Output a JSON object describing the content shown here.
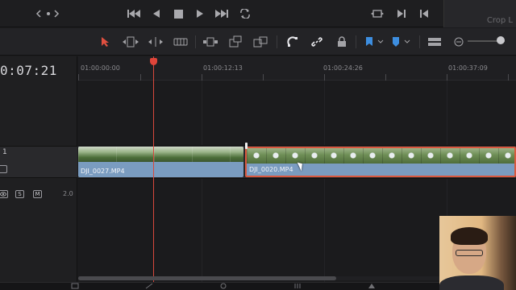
{
  "transport": {
    "buttons": [
      "chevron-left-icon",
      "dot-icon",
      "chevron-right-icon",
      "skip-back-icon",
      "play-reverse-icon",
      "stop-icon",
      "play-icon",
      "skip-forward-icon",
      "loop-icon",
      "match-frame-icon",
      "mark-in-icon",
      "mark-out-icon"
    ],
    "crop_label": "Crop L"
  },
  "toolbar": {
    "tools": [
      "selection-pointer",
      "trim-edit",
      "dynamic-trim",
      "blade-edit",
      "insert-clip",
      "overwrite-clip",
      "replace-clip",
      "snapping",
      "linked-selection",
      "position-lock",
      "flag",
      "marker",
      "zoom-full",
      "zoom-out"
    ]
  },
  "timeline": {
    "current_timecode": "0:07:21",
    "ruler_labels": [
      "01:00:00:00",
      "01:00:12:13",
      "01:00:24:26",
      "01:00:37:09"
    ],
    "video_track": {
      "number": "1"
    },
    "audio_track": {
      "buttons": [
        "S",
        "M"
      ],
      "level": "2.0"
    },
    "clips": [
      {
        "name": "DJI_0027.MP4",
        "selected": false
      },
      {
        "name": "DJI_0020.MP4",
        "selected": true
      }
    ]
  },
  "colors": {
    "playhead": "#d9483c",
    "clip": "#7a9cc0",
    "selection": "#d9583f"
  }
}
